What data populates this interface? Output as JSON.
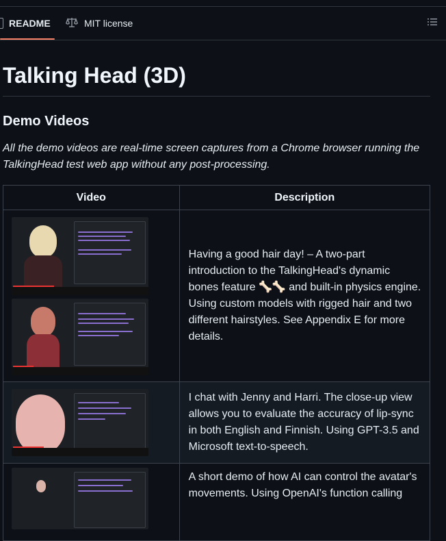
{
  "tabs": {
    "readme": "README",
    "license": "MIT license"
  },
  "title": "Talking Head (3D)",
  "section_heading": "Demo Videos",
  "intro": "All the demo videos are real-time screen captures from a Chrome browser running the TalkingHead test web app without any post-processing.",
  "table": {
    "headers": {
      "video": "Video",
      "description": "Description"
    },
    "rows": [
      {
        "description": "Having a good hair day! – A two-part introduction to the TalkingHead's dynamic bones feature 🦴🦴 and built-in physics engine. Using custom models with rigged hair and two different hairstyles. See Appendix E for more details."
      },
      {
        "description": "I chat with Jenny and Harri. The close-up view allows you to evaluate the accuracy of lip-sync in both English and Finnish. Using GPT-3.5 and Microsoft text-to-speech."
      },
      {
        "description": "A short demo of how AI can control the avatar's movements. Using OpenAI's function calling"
      }
    ]
  },
  "icons": {
    "readme_tab": "book-icon",
    "license_tab": "law-scale-icon",
    "outline": "list-unordered-icon"
  },
  "colors": {
    "background": "#0d1117",
    "border": "#30363d",
    "active_tab_underline": "#f78166",
    "alt_row": "#151b23"
  }
}
